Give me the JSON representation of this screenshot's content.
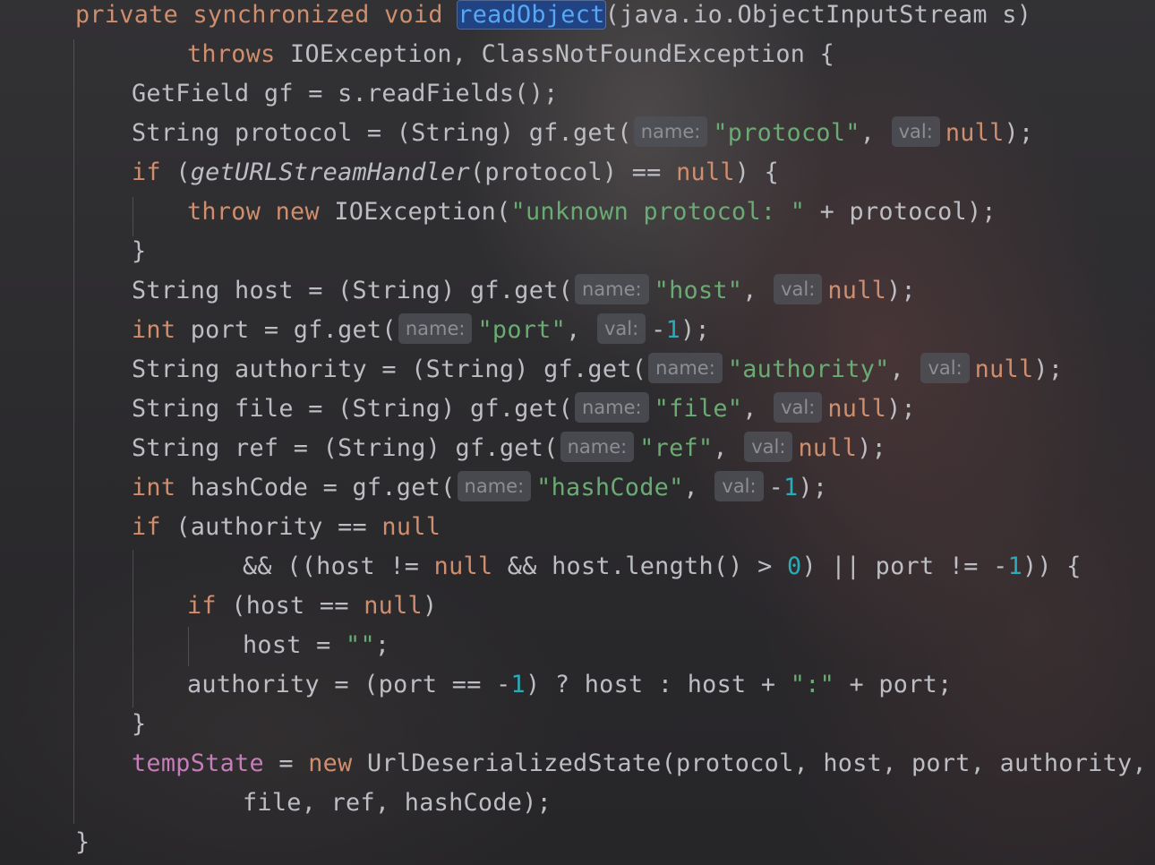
{
  "editor": {
    "lines": [
      [
        [
          "kw",
          "private synchronized void "
        ],
        [
          "sel",
          "readObject"
        ],
        [
          "plain",
          "(java.io.ObjectInputStream s)"
        ]
      ],
      [
        [
          "kw",
          "throws "
        ],
        [
          "plain",
          "IOException, ClassNotFoundException {"
        ]
      ],
      [
        [
          "plain",
          "GetField gf = s.readFields();"
        ]
      ],
      [
        [
          "plain",
          "String protocol = (String) gf.get("
        ],
        [
          "hint",
          "name:"
        ],
        [
          "str",
          "\"protocol\""
        ],
        [
          "plain",
          ", "
        ],
        [
          "hint",
          "val:"
        ],
        [
          "kw",
          "null"
        ],
        [
          "plain",
          ");"
        ]
      ],
      [
        [
          "kw",
          "if "
        ],
        [
          "plain",
          "("
        ],
        [
          "it",
          "getURLStreamHandler"
        ],
        [
          "plain",
          "(protocol) == "
        ],
        [
          "kw",
          "null"
        ],
        [
          "plain",
          ") {"
        ]
      ],
      [
        [
          "kw",
          "throw new "
        ],
        [
          "plain",
          "IOException("
        ],
        [
          "str",
          "\"unknown protocol: \""
        ],
        [
          "plain",
          " + protocol);"
        ]
      ],
      [
        [
          "plain",
          "}"
        ]
      ],
      [
        [
          "plain",
          "String host = (String) gf.get("
        ],
        [
          "hint",
          "name:"
        ],
        [
          "str",
          "\"host\""
        ],
        [
          "plain",
          ", "
        ],
        [
          "hint",
          "val:"
        ],
        [
          "kw",
          "null"
        ],
        [
          "plain",
          ");"
        ]
      ],
      [
        [
          "kw",
          "int "
        ],
        [
          "plain",
          "port = gf.get("
        ],
        [
          "hint",
          "name:"
        ],
        [
          "str",
          "\"port\""
        ],
        [
          "plain",
          ", "
        ],
        [
          "hint",
          "val:"
        ],
        [
          "plain",
          "-"
        ],
        [
          "num",
          "1"
        ],
        [
          "plain",
          ");"
        ]
      ],
      [
        [
          "plain",
          "String authority = (String) gf.get("
        ],
        [
          "hint",
          "name:"
        ],
        [
          "str",
          "\"authority\""
        ],
        [
          "plain",
          ", "
        ],
        [
          "hint",
          "val:"
        ],
        [
          "kw",
          "null"
        ],
        [
          "plain",
          ");"
        ]
      ],
      [
        [
          "plain",
          "String file = (String) gf.get("
        ],
        [
          "hint",
          "name:"
        ],
        [
          "str",
          "\"file\""
        ],
        [
          "plain",
          ", "
        ],
        [
          "hint",
          "val:"
        ],
        [
          "kw",
          "null"
        ],
        [
          "plain",
          ");"
        ]
      ],
      [
        [
          "plain",
          "String ref = (String) gf.get("
        ],
        [
          "hint",
          "name:"
        ],
        [
          "str",
          "\"ref\""
        ],
        [
          "plain",
          ", "
        ],
        [
          "hint",
          "val:"
        ],
        [
          "kw",
          "null"
        ],
        [
          "plain",
          ");"
        ]
      ],
      [
        [
          "kw",
          "int "
        ],
        [
          "plain",
          "hashCode = gf.get("
        ],
        [
          "hint",
          "name:"
        ],
        [
          "str",
          "\"hashCode\""
        ],
        [
          "plain",
          ", "
        ],
        [
          "hint",
          "val:"
        ],
        [
          "plain",
          "-"
        ],
        [
          "num",
          "1"
        ],
        [
          "plain",
          ");"
        ]
      ],
      [
        [
          "kw",
          "if "
        ],
        [
          "plain",
          "(authority == "
        ],
        [
          "kw",
          "null"
        ]
      ],
      [
        [
          "plain",
          "&& ((host != "
        ],
        [
          "kw",
          "null"
        ],
        [
          "plain",
          " && host.length() > "
        ],
        [
          "num",
          "0"
        ],
        [
          "plain",
          ") || port != -"
        ],
        [
          "num",
          "1"
        ],
        [
          "plain",
          ")) {"
        ]
      ],
      [
        [
          "kw",
          "if "
        ],
        [
          "plain",
          "(host == "
        ],
        [
          "kw",
          "null"
        ],
        [
          "plain",
          ")"
        ]
      ],
      [
        [
          "plain",
          "host = "
        ],
        [
          "str",
          "\"\""
        ],
        [
          "plain",
          ";"
        ]
      ],
      [
        [
          "plain",
          "authority = (port == -"
        ],
        [
          "num",
          "1"
        ],
        [
          "plain",
          ") ? host : host + "
        ],
        [
          "str",
          "\":\""
        ],
        [
          "plain",
          " + port;"
        ]
      ],
      [
        [
          "plain",
          "}"
        ]
      ],
      [
        [
          "fld",
          "tempState"
        ],
        [
          "plain",
          " = "
        ],
        [
          "kw",
          "new "
        ],
        [
          "plain",
          "UrlDeserializedState(protocol, host, port, authority,"
        ]
      ],
      [
        [
          "plain",
          "file, ref, hashCode);"
        ]
      ],
      [
        [
          "plain",
          "}"
        ]
      ]
    ]
  }
}
